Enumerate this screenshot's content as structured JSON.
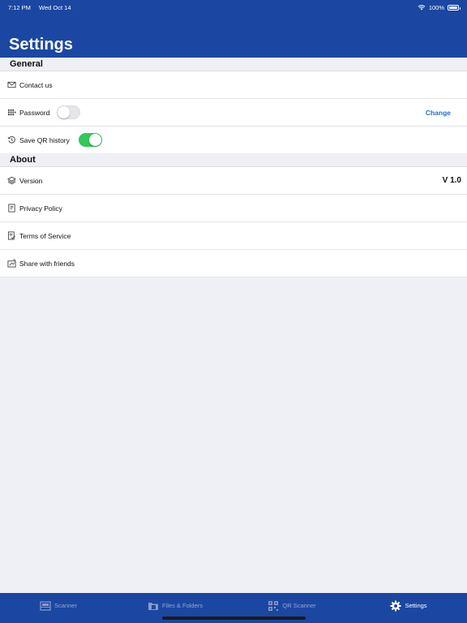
{
  "status_bar": {
    "time": "7:12 PM",
    "date": "Wed Oct 14",
    "battery": "100%"
  },
  "header": {
    "title": "Settings"
  },
  "sections": {
    "general": {
      "title": "General",
      "contact": "Contact us",
      "password": "Password",
      "password_toggle": false,
      "change": "Change",
      "save_qr": "Save QR history",
      "save_qr_toggle": true
    },
    "about": {
      "title": "About",
      "version": "Version",
      "version_value": "V 1.0",
      "privacy": "Privacy Policy",
      "terms": "Terms of Service",
      "share": "Share with friends"
    }
  },
  "tabbar": {
    "scanner": "Scanner",
    "files": "Files & Folders",
    "qr": "QR Scanner",
    "settings": "Settings",
    "active": "settings"
  },
  "colors": {
    "primary": "#1b47a3",
    "toggle_on": "#34c759",
    "link": "#1f6fd6"
  }
}
